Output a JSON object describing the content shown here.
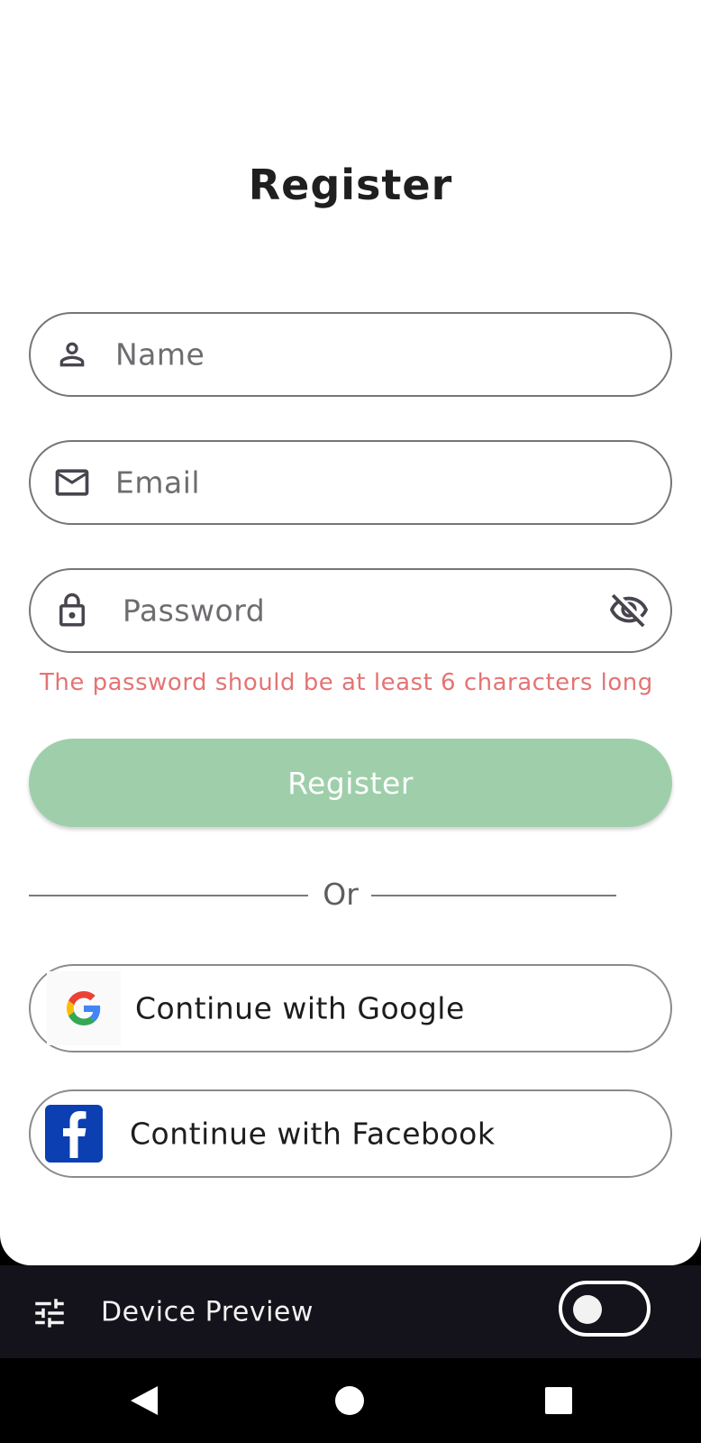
{
  "page": {
    "title": "Register"
  },
  "form": {
    "name": {
      "placeholder": "Name",
      "icon": "person-icon"
    },
    "email": {
      "placeholder": "Email",
      "icon": "mail-icon"
    },
    "password": {
      "placeholder": "Password",
      "icon": "lock-icon",
      "toggle_icon": "visibility-off-icon"
    },
    "password_error": "The password should be at least 6 characters long",
    "submit_label": "Register"
  },
  "divider": {
    "label": "Or"
  },
  "social": {
    "google_label": "Continue with Google",
    "facebook_label": "Continue with Facebook"
  },
  "device_preview": {
    "label": "Device Preview",
    "toggle_on": false
  },
  "colors": {
    "primary_disabled": "#9ecfaa",
    "error": "#e57373",
    "facebook_blue": "#0b3fb2",
    "preview_bar": "#14121a"
  }
}
